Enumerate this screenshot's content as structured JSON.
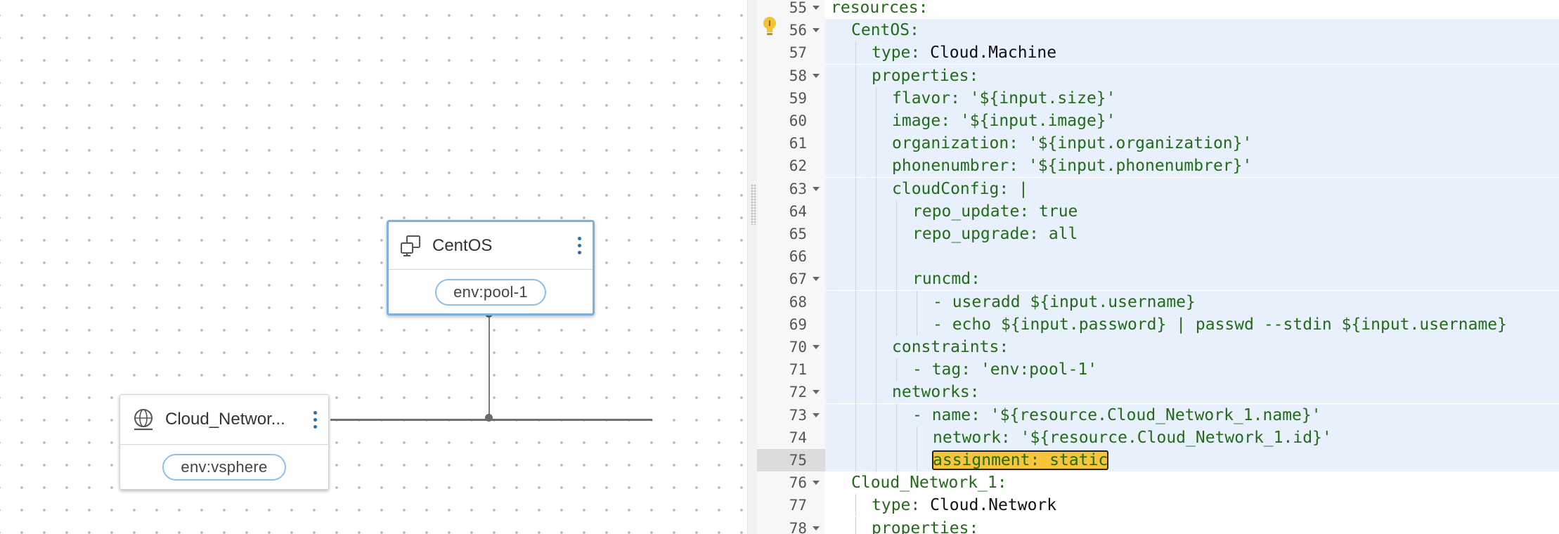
{
  "canvas": {
    "nodes": [
      {
        "title": "CentOS",
        "tag": "env:pool-1",
        "icon": "machine-icon"
      },
      {
        "title": "Cloud_Networ...",
        "tag": "env:vsphere",
        "icon": "network-icon"
      }
    ]
  },
  "editor": {
    "current_line": 75,
    "highlight_range": [
      56,
      75
    ],
    "lines": [
      {
        "n": "55",
        "fold": true,
        "indent": 0,
        "key": "resources:",
        "val": ""
      },
      {
        "n": "56",
        "fold": true,
        "indent": 1,
        "key": "CentOS:",
        "val": ""
      },
      {
        "n": "57",
        "fold": false,
        "indent": 2,
        "key": "type:",
        "val": " Cloud.Machine",
        "plain": true
      },
      {
        "n": "58",
        "fold": true,
        "indent": 2,
        "key": "properties:",
        "val": ""
      },
      {
        "n": "59",
        "fold": false,
        "indent": 3,
        "key": "flavor:",
        "val": " '${input.size}'"
      },
      {
        "n": "60",
        "fold": false,
        "indent": 3,
        "key": "image:",
        "val": " '${input.image}'"
      },
      {
        "n": "61",
        "fold": false,
        "indent": 3,
        "key": "organization:",
        "val": " '${input.organization}'"
      },
      {
        "n": "62",
        "fold": false,
        "indent": 3,
        "key": "phonenumbrer:",
        "val": " '${input.phonenumbrer}'"
      },
      {
        "n": "63",
        "fold": true,
        "indent": 3,
        "key": "cloudConfig:",
        "val": " |"
      },
      {
        "n": "64",
        "fold": false,
        "indent": 4,
        "key": "repo_update:",
        "val": " true"
      },
      {
        "n": "65",
        "fold": false,
        "indent": 4,
        "key": "repo_upgrade:",
        "val": " all"
      },
      {
        "n": "66",
        "fold": false,
        "indent": 4,
        "key": "",
        "val": ""
      },
      {
        "n": "67",
        "fold": true,
        "indent": 4,
        "key": "runcmd:",
        "val": ""
      },
      {
        "n": "68",
        "fold": false,
        "indent": 5,
        "key": "- useradd",
        "val": " ${input.username}"
      },
      {
        "n": "69",
        "fold": false,
        "indent": 5,
        "key": "- echo",
        "val": " ${input.password} | passwd --stdin ${input.username}"
      },
      {
        "n": "70",
        "fold": true,
        "indent": 3,
        "key": "constraints:",
        "val": ""
      },
      {
        "n": "71",
        "fold": false,
        "indent": 4,
        "key": "- tag:",
        "val": " 'env:pool-1'"
      },
      {
        "n": "72",
        "fold": true,
        "indent": 3,
        "key": "networks:",
        "val": ""
      },
      {
        "n": "73",
        "fold": true,
        "indent": 4,
        "key": "- name:",
        "val": " '${resource.Cloud_Network_1.name}'"
      },
      {
        "n": "74",
        "fold": false,
        "indent": 5,
        "key": "network:",
        "val": " '${resource.Cloud_Network_1.id}'"
      },
      {
        "n": "75",
        "fold": false,
        "indent": 5,
        "key": "assignment:",
        "val": " static",
        "selected": true
      },
      {
        "n": "76",
        "fold": true,
        "indent": 1,
        "key": "Cloud_Network_1:",
        "val": ""
      },
      {
        "n": "77",
        "fold": false,
        "indent": 2,
        "key": "type:",
        "val": " Cloud.Network",
        "plain": true
      },
      {
        "n": "78",
        "fold": true,
        "indent": 2,
        "key": "properties:",
        "val": ""
      }
    ]
  }
}
